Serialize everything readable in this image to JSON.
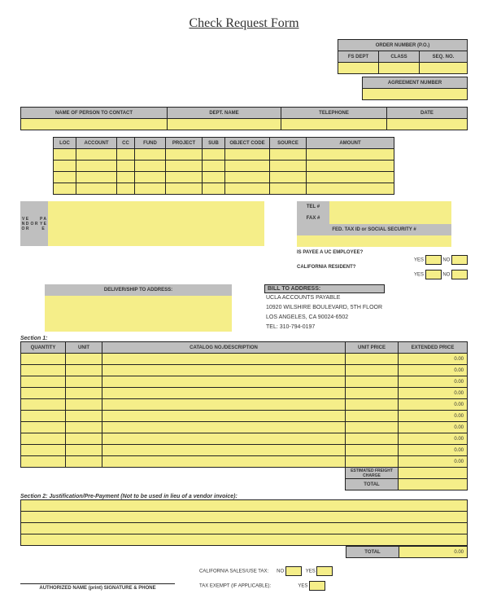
{
  "title": "Check Request Form",
  "order": {
    "hdr": "ORDER NUMBER (P.O.)",
    "fsdept": "FS DEPT",
    "class": "CLASS",
    "seqno": "SEQ. NO.",
    "agreement": "AGREEMENT NUMBER"
  },
  "contacts": {
    "name": "NAME OF PERSON TO CONTACT",
    "dept": "DEPT. NAME",
    "tel": "TELEPHONE",
    "date": "DATE"
  },
  "acct": {
    "loc": "LOC",
    "account": "ACCOUNT",
    "cc": "CC",
    "fund": "FUND",
    "project": "PROJECT",
    "sub": "SUB",
    "object": "OBJECT CODE",
    "source": "SOURCE",
    "amount": "AMOUNT"
  },
  "vendor": {
    "side1": "V E N D O R",
    "or": "O R",
    "side2": "P A Y E E",
    "tel": "TEL #",
    "fax": "FAX #",
    "fed": "FED. TAX ID or SOCIAL SECURITY #",
    "emp": "IS PAYEE A UC EMPLOYEE?",
    "cal": "CALIFORNIA RESIDENT?",
    "yes": "YES",
    "no": "NO"
  },
  "deliver": "DELIVER/SHIP TO ADDRESS:",
  "bill": {
    "hdr": "BILL TO ADDRESS:",
    "l1": "UCLA ACCOUNTS PAYABLE",
    "l2": "10920 WILSHIRE BOULEVARD, 5TH FLOOR",
    "l3": "LOS ANGELES, CA 90024-6502",
    "l4": "TEL: 310-794-0197"
  },
  "sec1": "Section 1:",
  "items": {
    "qty": "QUANTITY",
    "unit": "UNIT",
    "catalog": "CATALOG NO./DESCRIPTION",
    "uprice": "UNIT PRICE",
    "eprice": "EXTENDED PRICE",
    "zero": "0.00",
    "freight": "ESTIMATED FREIGHT CHARGE",
    "total": "TOTAL"
  },
  "sec2": "Section 2: Justification/Pre-Payment (Not to be used in lieu of a vendor invoice):",
  "footer": {
    "total": "TOTAL",
    "zero": "0.00",
    "tax": "CALIFORNIA SALES/USE TAX:",
    "exempt": "TAX EXEMPT (IF APPLICABLE):",
    "yes": "YES",
    "no": "NO",
    "sig": "AUTHORIZED NAME (print) SIGNATURE & PHONE"
  }
}
